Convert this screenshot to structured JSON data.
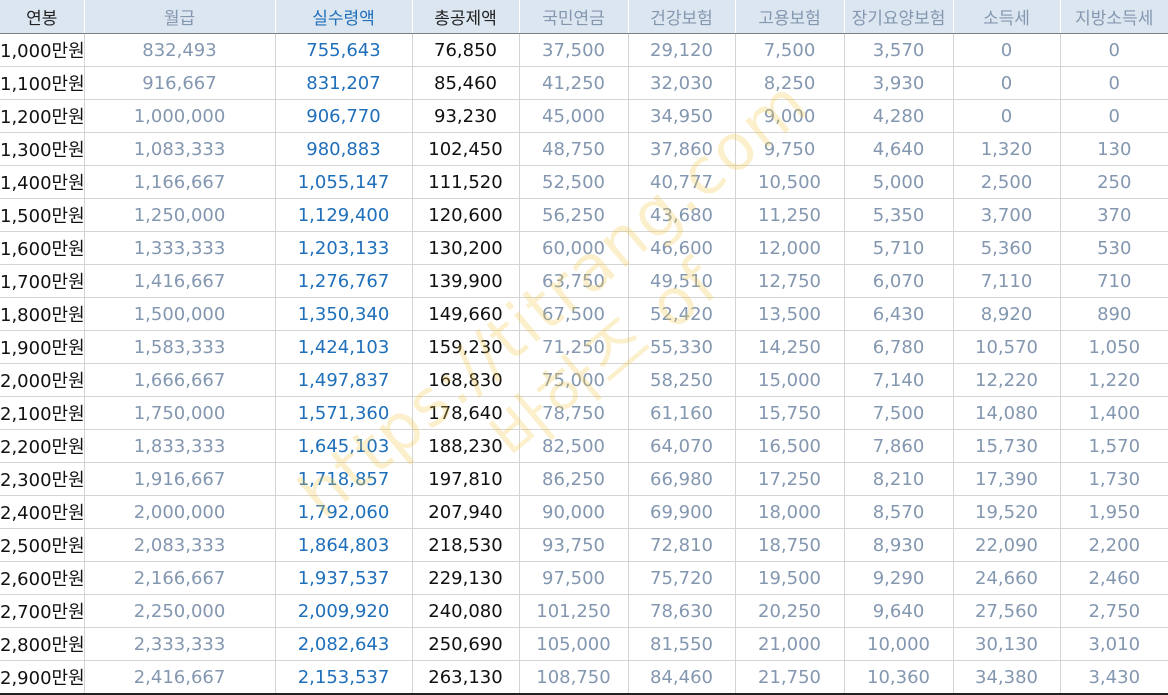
{
  "table": {
    "headers": [
      "연봉",
      "월급",
      "실수령액",
      "총공제액",
      "국민연금",
      "건강보험",
      "고용보험",
      "장기요양보험",
      "소득세",
      "지방소득세"
    ],
    "header_colors": [
      "#222222",
      "#8497b0",
      "#1f6fba",
      "#222222",
      "#8497b0",
      "#8497b0",
      "#8497b0",
      "#8497b0",
      "#8497b0",
      "#8497b0"
    ],
    "rows": [
      [
        "1,000만원",
        "832,493",
        "755,643",
        "76,850",
        "37,500",
        "29,120",
        "7,500",
        "3,570",
        "0",
        "0"
      ],
      [
        "1,100만원",
        "916,667",
        "831,207",
        "85,460",
        "41,250",
        "32,030",
        "8,250",
        "3,930",
        "0",
        "0"
      ],
      [
        "1,200만원",
        "1,000,000",
        "906,770",
        "93,230",
        "45,000",
        "34,950",
        "9,000",
        "4,280",
        "0",
        "0"
      ],
      [
        "1,300만원",
        "1,083,333",
        "980,883",
        "102,450",
        "48,750",
        "37,860",
        "9,750",
        "4,640",
        "1,320",
        "130"
      ],
      [
        "1,400만원",
        "1,166,667",
        "1,055,147",
        "111,520",
        "52,500",
        "40,777",
        "10,500",
        "5,000",
        "2,500",
        "250"
      ],
      [
        "1,500만원",
        "1,250,000",
        "1,129,400",
        "120,600",
        "56,250",
        "43,680",
        "11,250",
        "5,350",
        "3,700",
        "370"
      ],
      [
        "1,600만원",
        "1,333,333",
        "1,203,133",
        "130,200",
        "60,000",
        "46,600",
        "12,000",
        "5,710",
        "5,360",
        "530"
      ],
      [
        "1,700만원",
        "1,416,667",
        "1,276,767",
        "139,900",
        "63,750",
        "49,510",
        "12,750",
        "6,070",
        "7,110",
        "710"
      ],
      [
        "1,800만원",
        "1,500,000",
        "1,350,340",
        "149,660",
        "67,500",
        "52,420",
        "13,500",
        "6,430",
        "8,920",
        "890"
      ],
      [
        "1,900만원",
        "1,583,333",
        "1,424,103",
        "159,230",
        "71,250",
        "55,330",
        "14,250",
        "6,780",
        "10,570",
        "1,050"
      ],
      [
        "2,000만원",
        "1,666,667",
        "1,497,837",
        "168,830",
        "75,000",
        "58,250",
        "15,000",
        "7,140",
        "12,220",
        "1,220"
      ],
      [
        "2,100만원",
        "1,750,000",
        "1,571,360",
        "178,640",
        "78,750",
        "61,160",
        "15,750",
        "7,500",
        "14,080",
        "1,400"
      ],
      [
        "2,200만원",
        "1,833,333",
        "1,645,103",
        "188,230",
        "82,500",
        "64,070",
        "16,500",
        "7,860",
        "15,730",
        "1,570"
      ],
      [
        "2,300만원",
        "1,916,667",
        "1,718,857",
        "197,810",
        "86,250",
        "66,980",
        "17,250",
        "8,210",
        "17,390",
        "1,730"
      ],
      [
        "2,400만원",
        "2,000,000",
        "1,792,060",
        "207,940",
        "90,000",
        "69,900",
        "18,000",
        "8,570",
        "19,520",
        "1,950"
      ],
      [
        "2,500만원",
        "2,083,333",
        "1,864,803",
        "218,530",
        "93,750",
        "72,810",
        "18,750",
        "8,930",
        "22,090",
        "2,200"
      ],
      [
        "2,600만원",
        "2,166,667",
        "1,937,537",
        "229,130",
        "97,500",
        "75,720",
        "19,500",
        "9,290",
        "24,660",
        "2,460"
      ],
      [
        "2,700만원",
        "2,250,000",
        "2,009,920",
        "240,080",
        "101,250",
        "78,630",
        "20,250",
        "9,640",
        "27,560",
        "2,750"
      ],
      [
        "2,800만원",
        "2,333,333",
        "2,082,643",
        "250,690",
        "105,000",
        "81,550",
        "21,000",
        "10,000",
        "30,130",
        "3,010"
      ],
      [
        "2,900만원",
        "2,416,667",
        "2,153,537",
        "263,130",
        "108,750",
        "84,460",
        "21,750",
        "10,360",
        "34,380",
        "3,430"
      ]
    ]
  },
  "watermark": {
    "line1": "https://titrang.com",
    "line2": "바하즈 of"
  }
}
